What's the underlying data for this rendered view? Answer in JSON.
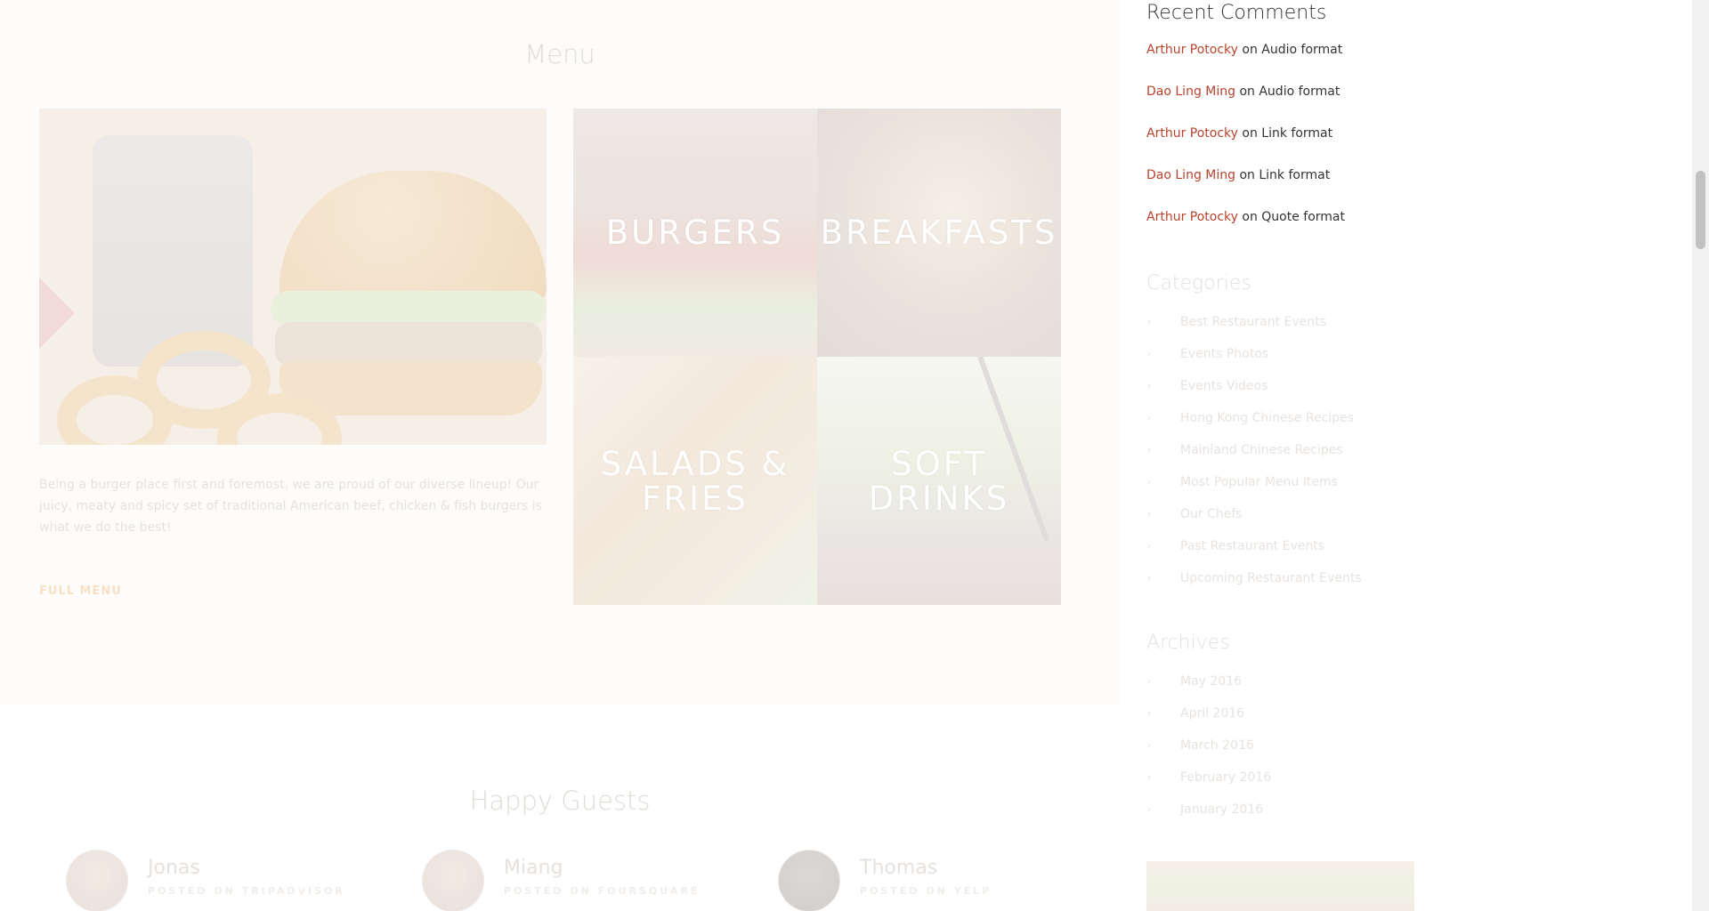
{
  "menu": {
    "title": "Menu",
    "description": "Being a burger place first and foremost, we are proud of our diverse lineup! Our juicy, meaty and spicy set of traditional American beef, chicken & fish burgers is what we do the best!",
    "full_menu_label": "FULL MENU",
    "tiles": [
      {
        "label": "BURGERS"
      },
      {
        "label": "BREAKFASTS"
      },
      {
        "label": "SALADS & FRIES"
      },
      {
        "label": "SOFT DRINKS"
      }
    ]
  },
  "guests": {
    "title": "Happy Guests",
    "items": [
      {
        "name": "Jonas",
        "source": "POSTED ON TRIPADVISOR"
      },
      {
        "name": "Miang",
        "source": "POSTED ON FOURSQUARE"
      },
      {
        "name": "Thomas",
        "source": "POSTED ON YELP"
      }
    ]
  },
  "sidebar": {
    "recent_comments": {
      "title": "Recent Comments",
      "connector": "on",
      "items": [
        {
          "author": "Arthur Potocky",
          "post": "Audio format"
        },
        {
          "author": "Dao Ling Ming",
          "post": "Audio format"
        },
        {
          "author": "Arthur Potocky",
          "post": "Link format"
        },
        {
          "author": "Dao Ling Ming",
          "post": "Link format"
        },
        {
          "author": "Arthur Potocky",
          "post": "Quote format"
        }
      ]
    },
    "categories": {
      "title": "Categories",
      "items": [
        "Best Restaurant Events",
        "Events Photos",
        "Events Videos",
        "Hong Kong Chinese Recipes",
        "Mainland Chinese Recipes",
        "Most Popular Menu Items",
        "Our Chefs",
        "Past Restaurant Events",
        "Upcoming Restaurant Events"
      ]
    },
    "archives": {
      "title": "Archives",
      "items": [
        "May 2016",
        "April 2016",
        "March 2016",
        "February 2016",
        "January 2016"
      ]
    },
    "chevron_glyph": "›"
  },
  "colors": {
    "link_accent": "#b8432d",
    "menu_bg": "#fefcfa",
    "faded_text": "#e6e1dc"
  }
}
